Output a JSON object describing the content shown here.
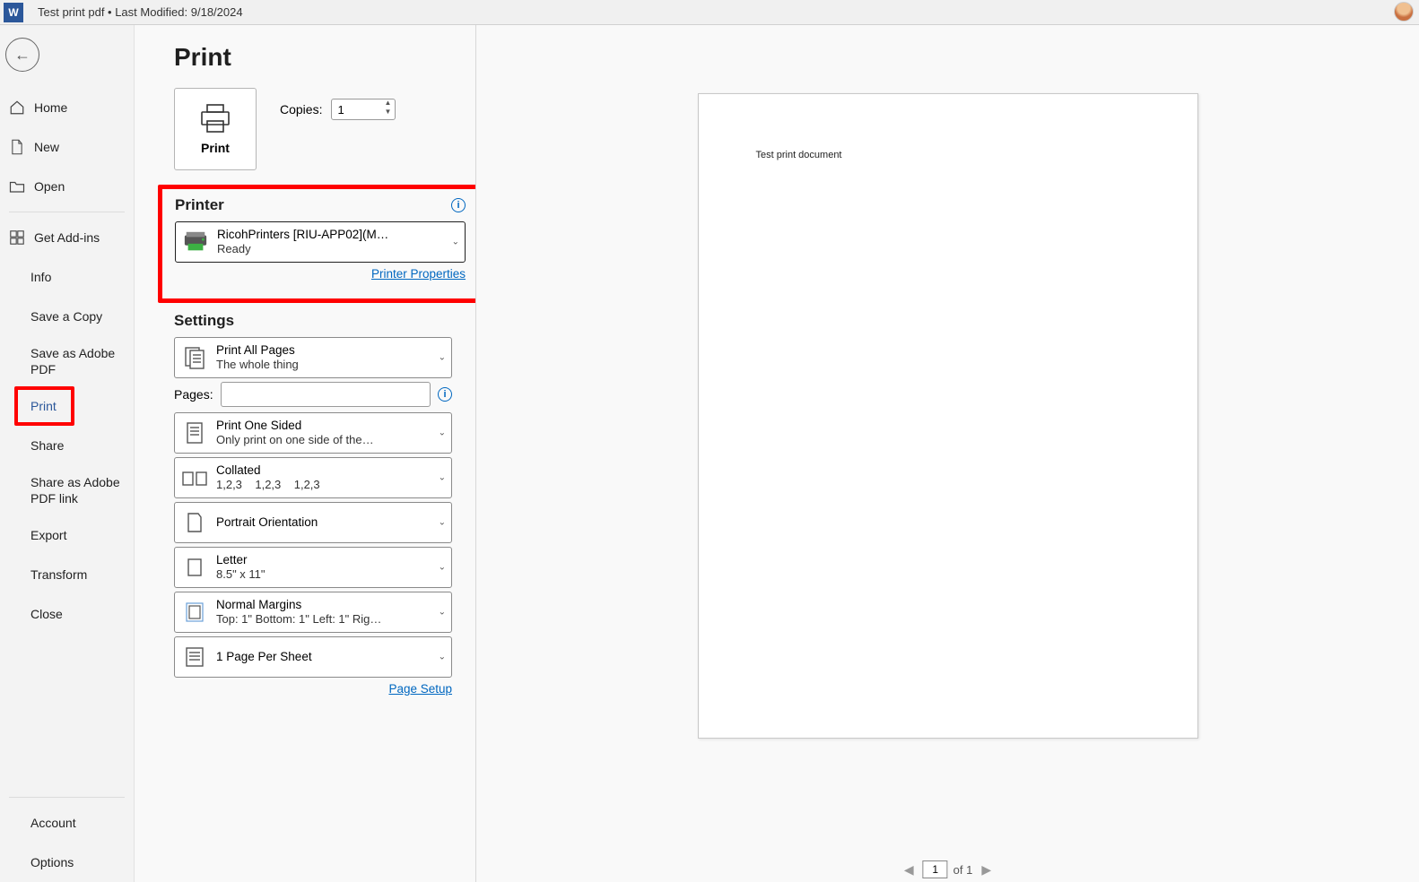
{
  "title": "Test print pdf • Last Modified: 9/18/2024",
  "sidebar": {
    "home": "Home",
    "new": "New",
    "open": "Open",
    "addins": "Get Add-ins",
    "info": "Info",
    "savecopy": "Save a Copy",
    "saveadobe": "Save as Adobe PDF",
    "print": "Print",
    "share": "Share",
    "shareadobe": "Share as Adobe PDF link",
    "export": "Export",
    "transform": "Transform",
    "close": "Close",
    "account": "Account",
    "options": "Options"
  },
  "print": {
    "title": "Print",
    "copies_label": "Copies:",
    "copies_value": "1",
    "print_label": "Print",
    "printer_section": "Printer",
    "printer_name": "RicohPrinters [RIU-APP02](M…",
    "printer_status": "Ready",
    "printer_props": "Printer Properties",
    "settings_section": "Settings",
    "print_all": "Print All Pages",
    "print_all_sub": "The whole thing",
    "pages_label": "Pages:",
    "one_sided": "Print One Sided",
    "one_sided_sub": "Only print on one side of the…",
    "collated": "Collated",
    "collated_sub": "1,2,3    1,2,3    1,2,3",
    "orientation": "Portrait Orientation",
    "letter": "Letter",
    "letter_sub": "8.5\" x 11\"",
    "margins": "Normal Margins",
    "margins_sub": "Top: 1\" Bottom: 1\" Left: 1\" Rig…",
    "perpage": "1 Page Per Sheet",
    "page_setup": "Page Setup"
  },
  "preview": {
    "doc_text": "Test print document",
    "page_current": "1",
    "page_of": "of 1"
  }
}
